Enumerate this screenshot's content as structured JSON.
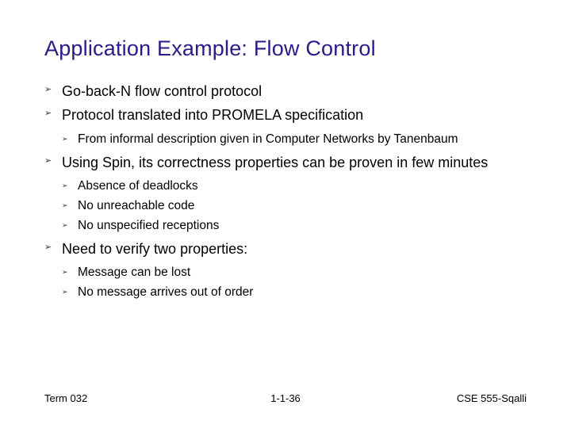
{
  "title": "Application Example: Flow Control",
  "bullets": {
    "b0": "Go-back-N flow control protocol",
    "b1": "Protocol translated into PROMELA specification",
    "b1_sub": {
      "s0": "From informal description given in Computer Networks by Tanenbaum"
    },
    "b2": "Using Spin, its correctness properties can be proven in few minutes",
    "b2_sub": {
      "s0": "Absence of deadlocks",
      "s1": "No unreachable code",
      "s2": "No unspecified receptions"
    },
    "b3": "Need to verify two properties:",
    "b3_sub": {
      "s0": "Message can be lost",
      "s1": "No message arrives out of order"
    }
  },
  "footer": {
    "left": "Term 032",
    "center": "1-1-36",
    "right": "CSE 555-Sqalli"
  }
}
